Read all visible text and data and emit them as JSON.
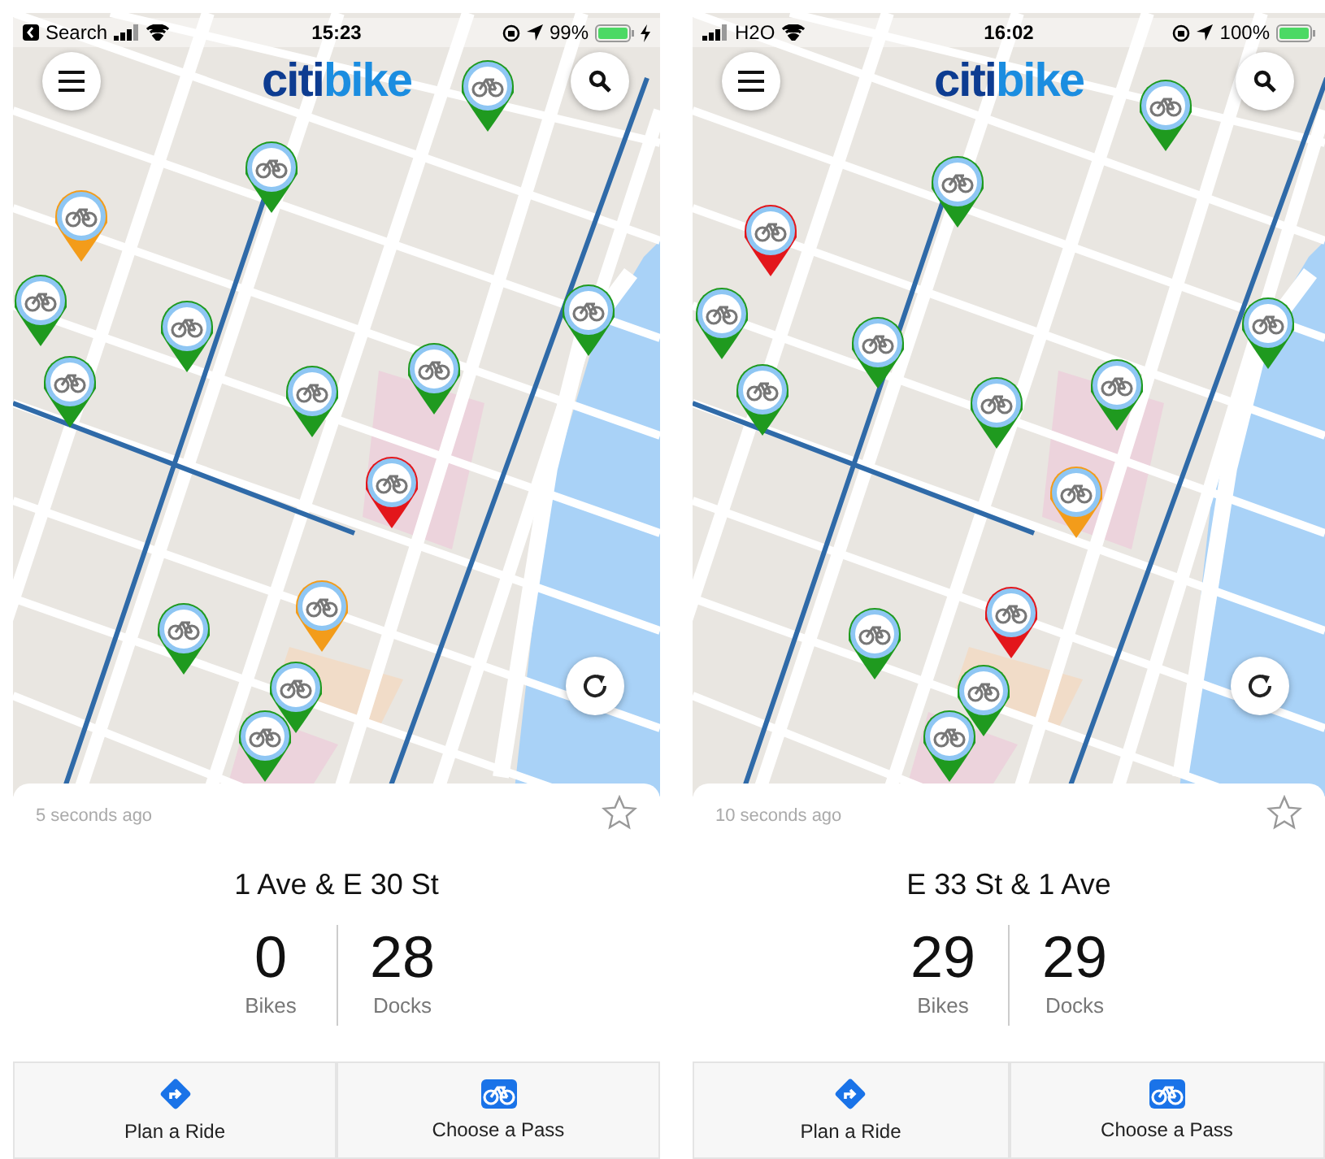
{
  "phones": [
    {
      "status_bar": {
        "back_link": true,
        "carrier": "Search",
        "time": "15:23",
        "battery": "99%",
        "charging": true
      },
      "logo": [
        "citi",
        "bike"
      ],
      "pins": [
        {
          "color": "#1f9a1f"
        },
        {
          "color": "#1f9a1f"
        },
        {
          "color": "#f39c1a"
        },
        {
          "color": "#1f9a1f"
        },
        {
          "color": "#1f9a1f"
        },
        {
          "color": "#1f9a1f"
        },
        {
          "color": "#1f9a1f"
        },
        {
          "color": "#1f9a1f"
        },
        {
          "color": "#1f9a1f"
        },
        {
          "color": "#e3161b"
        },
        {
          "color": "#1f9a1f"
        },
        {
          "color": "#f39c1a"
        },
        {
          "color": "#1f9a1f"
        },
        {
          "color": "#1f9a1f"
        }
      ],
      "station": {
        "updated": "5 seconds ago",
        "favorite": false,
        "name": "1 Ave & E 30 St",
        "bikes": "0",
        "bikes_label": "Bikes",
        "docks": "28",
        "docks_label": "Docks"
      },
      "actions": [
        {
          "kind": "route",
          "label": "Plan a Ride"
        },
        {
          "kind": "pass",
          "label": "Choose a Pass"
        }
      ]
    },
    {
      "status_bar": {
        "back_link": false,
        "carrier": "H2O",
        "time": "16:02",
        "battery": "100%",
        "charging": false
      },
      "logo": [
        "citi",
        "bike"
      ],
      "pins": [
        {
          "color": "#1f9a1f"
        },
        {
          "color": "#1f9a1f"
        },
        {
          "color": "#e3161b"
        },
        {
          "color": "#1f9a1f"
        },
        {
          "color": "#1f9a1f"
        },
        {
          "color": "#1f9a1f"
        },
        {
          "color": "#1f9a1f"
        },
        {
          "color": "#1f9a1f"
        },
        {
          "color": "#1f9a1f"
        },
        {
          "color": "#f39c1a"
        },
        {
          "color": "#1f9a1f"
        },
        {
          "color": "#e3161b"
        },
        {
          "color": "#1f9a1f"
        },
        {
          "color": "#1f9a1f"
        }
      ],
      "station": {
        "updated": "10 seconds ago",
        "favorite": false,
        "name": "E 33 St & 1 Ave",
        "bikes": "29",
        "bikes_label": "Bikes",
        "docks": "29",
        "docks_label": "Docks"
      },
      "actions": [
        {
          "kind": "route",
          "label": "Plan a Ride"
        },
        {
          "kind": "pass",
          "label": "Choose a Pass"
        }
      ]
    }
  ]
}
